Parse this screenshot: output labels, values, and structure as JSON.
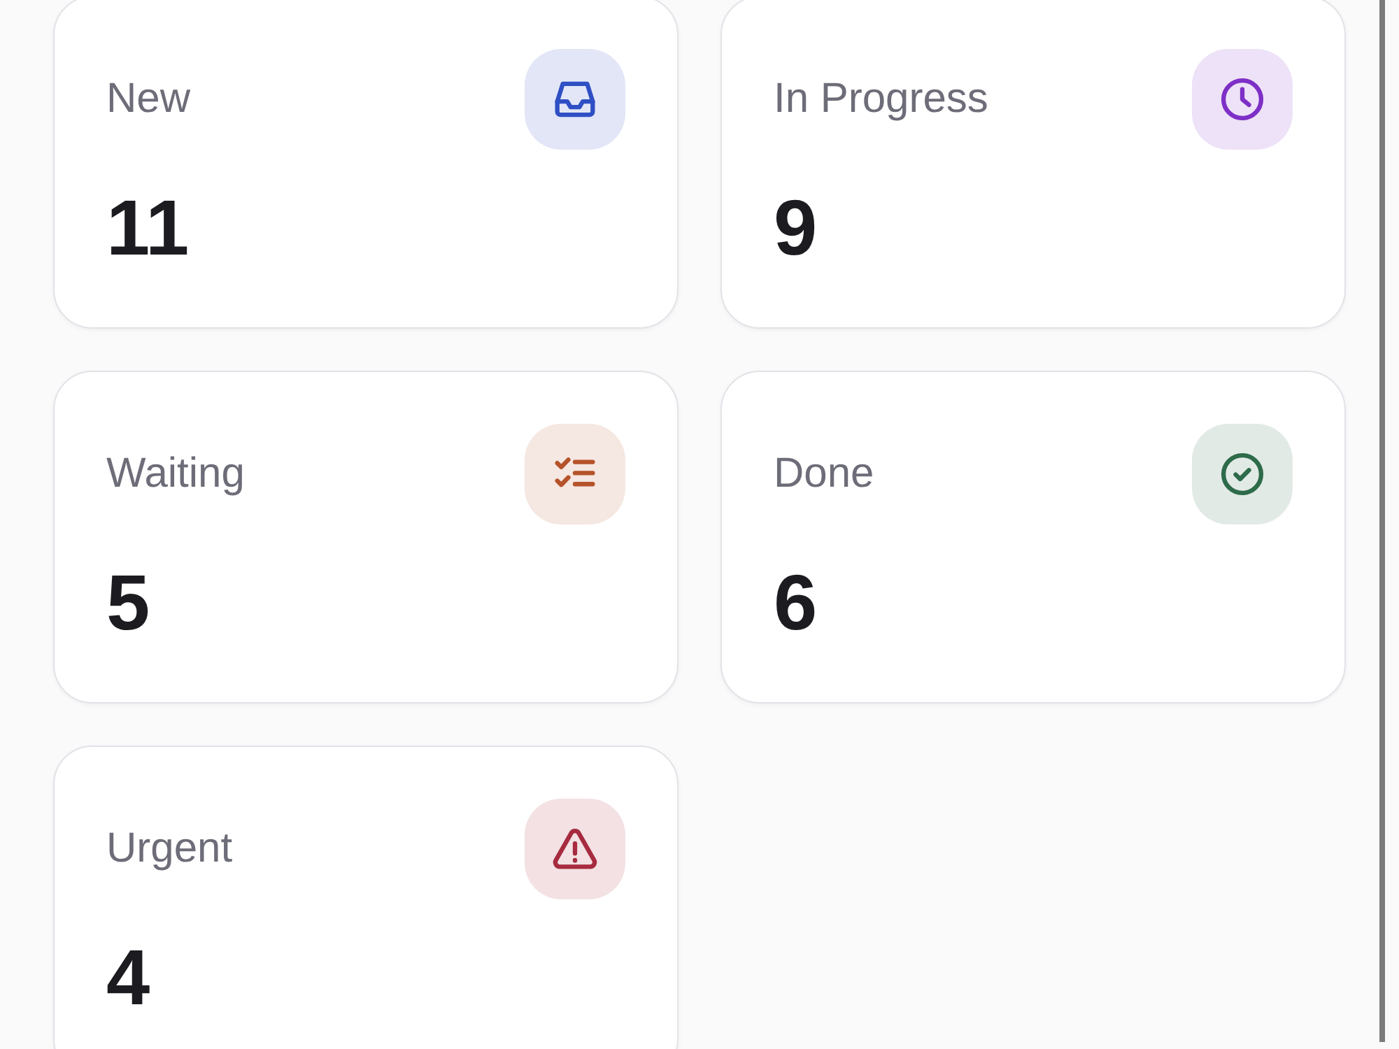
{
  "cards": [
    {
      "label": "New",
      "value": "11",
      "kind": "inbox",
      "color": "#2f4fc4"
    },
    {
      "label": "In Progress",
      "value": "9",
      "kind": "clock",
      "color": "#7e2fc6"
    },
    {
      "label": "Waiting",
      "value": "5",
      "kind": "checklist",
      "color": "#b5532a"
    },
    {
      "label": "Done",
      "value": "6",
      "kind": "check-circle",
      "color": "#2d6b4a"
    },
    {
      "label": "Urgent",
      "value": "4",
      "kind": "warning",
      "color": "#a72b3f"
    }
  ]
}
